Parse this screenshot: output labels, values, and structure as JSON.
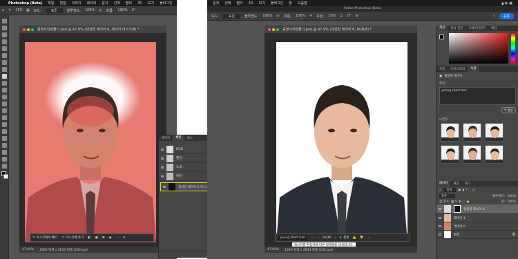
{
  "left": {
    "menu": [
      "Photoshop (Beta)",
      "파일",
      "편집",
      "이미지",
      "레이어",
      "문자",
      "선택",
      "필터",
      "3D",
      "보기",
      "플러그인"
    ],
    "options": {
      "mode_label": "모드:",
      "mode_value": "표준",
      "opacity_label": "불투명도:",
      "opacity_value": "100%",
      "flow_label": "흐름:",
      "flow_value": "100%",
      "brush_size": "250",
      "angle": "0°"
    },
    "doc_title": "증명사진만들기.psd @ 47.9% (생성형 레이어 6, 레이어 마스크/8) *",
    "mask_bar": {
      "select_mask_label": "마스크에서 빼기",
      "add_mask_label": "마스크에 추가"
    },
    "status": {
      "zoom": "47.94%",
      "size": "1890 픽셀 x 2833 픽셀 (240 ppi)"
    },
    "channels": {
      "tabs": [
        "레이어",
        "채널",
        "패스"
      ],
      "rows": [
        {
          "name": "RGB",
          "shortcut": "⌘2"
        },
        {
          "name": "빨강",
          "shortcut": "⌘3"
        },
        {
          "name": "녹색",
          "shortcut": "⌘4"
        },
        {
          "name": "파랑",
          "shortcut": "⌘5"
        },
        {
          "name": "생성형 레이어 6 마스크",
          "shortcut": "⌘\\"
        }
      ]
    }
  },
  "right": {
    "menu": [
      "문자",
      "선택",
      "필터",
      "3D",
      "보기",
      "플러그인",
      "창",
      "도움말"
    ],
    "app_title": "Adobe Photoshop (Beta)",
    "options": {
      "mode_label": "모드:",
      "mode_value": "표준",
      "opacity_label": "불투명도:",
      "opacity_value": "100%",
      "flow_label": "흐름:",
      "flow_value": "100%",
      "smooth_label": "보정:",
      "smooth_value": "10%",
      "angle": "0°",
      "share_label": "공유"
    },
    "doc_title": "증명사진만들기.psd @ 47.9% (생성형 레이어 6, RGB/8) *",
    "prompt_bar": {
      "prompt": "young short hair",
      "counter": "10/36",
      "generate_label": "생성"
    },
    "tooltip": "메시지를 편집하여 다른 결과물을 생성합니다.",
    "status": {
      "zoom": "47.94%",
      "size": "1890 픽셀 x 2833 픽셀 (240 ppi)"
    },
    "color_tabs": [
      "색상",
      "색상 견본",
      "그레이디언트",
      "패턴"
    ],
    "props": {
      "tabs": [
        "조정",
        "라이브러리",
        "속성"
      ],
      "layer_type": "생성형 레이어",
      "prompt_label": "확인:",
      "prompt_value": "young short hair",
      "generate_label": "생성",
      "variations_label": "변형"
    },
    "layers": {
      "tabs": [
        "레이어",
        "채널",
        "패스"
      ],
      "kind_label": "종류",
      "blend_mode": "표준",
      "opacity_label": "불투명도:",
      "opacity_value": "100%",
      "lock_label": "잠그기:",
      "fill_label": "칠:",
      "fill_value": "100%",
      "rows": [
        {
          "name": "생성형 레이어 6"
        },
        {
          "name": "레이어 1"
        },
        {
          "name": "레이어 0"
        },
        {
          "name": "배경"
        }
      ]
    }
  },
  "colors": {
    "accent": "#1473e6",
    "mask_red": "#e87a72",
    "highlight": "#e1e11a",
    "panel": "#535353",
    "dark": "#3c3c3c"
  }
}
